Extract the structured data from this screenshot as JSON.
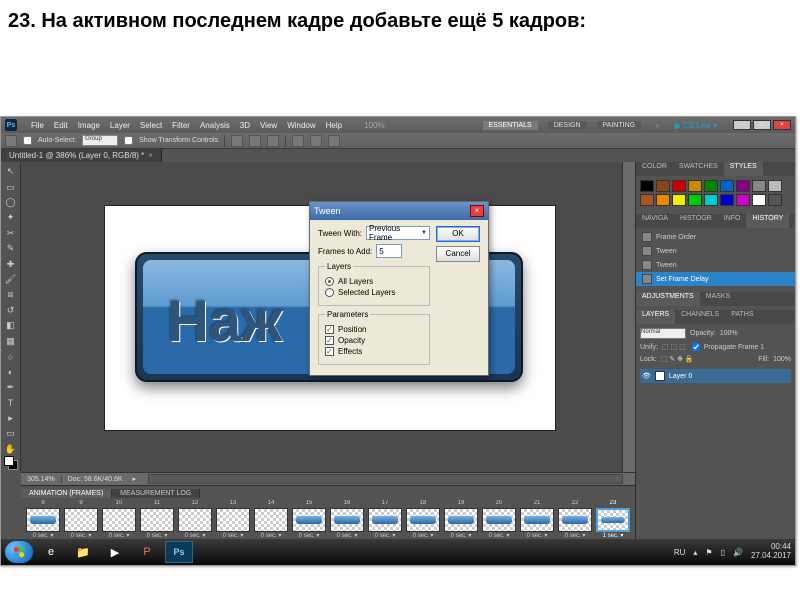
{
  "slide": {
    "title": "23. На активном последнем кадре добавьте ещё 5 кадров:"
  },
  "menubar": {
    "items": [
      "File",
      "Edit",
      "Image",
      "Layer",
      "Select",
      "Filter",
      "Analysis",
      "3D",
      "View",
      "Window",
      "Help"
    ],
    "zoom": "100%",
    "workspaces": {
      "essentials": "ESSENTIALS",
      "design": "DESIGN",
      "painting": "PAINTING"
    },
    "cslive": "CS Live"
  },
  "optbar": {
    "autoSelect": "Auto-Select:",
    "group": "Group",
    "showTransform": "Show Transform Controls"
  },
  "doctab": {
    "title": "Untitled-1 @ 386% (Layer 0, RGB/8) *"
  },
  "canvasText": "Наж",
  "statusbar": {
    "zoom": "305.14%",
    "doc": "Doc: 58.6K/40.6K"
  },
  "anim": {
    "tabs": {
      "frames": "ANIMATION (FRAMES)",
      "log": "MEASUREMENT LOG"
    },
    "frames": [
      {
        "n": "8",
        "d": "0 sec.",
        "btn": true
      },
      {
        "n": "9",
        "d": "0 sec.",
        "btn": false
      },
      {
        "n": "10",
        "d": "0 sec.",
        "btn": false
      },
      {
        "n": "11",
        "d": "0 sec.",
        "btn": false
      },
      {
        "n": "12",
        "d": "0 sec.",
        "btn": false
      },
      {
        "n": "13",
        "d": "0 sec.",
        "btn": false
      },
      {
        "n": "14",
        "d": "0 sec.",
        "btn": false
      },
      {
        "n": "15",
        "d": "0 sec.",
        "btn": true
      },
      {
        "n": "16",
        "d": "0 sec.",
        "btn": true
      },
      {
        "n": "17",
        "d": "0 sec.",
        "btn": true
      },
      {
        "n": "18",
        "d": "0 sec.",
        "btn": true
      },
      {
        "n": "19",
        "d": "0 sec.",
        "btn": true
      },
      {
        "n": "20",
        "d": "0 sec.",
        "btn": true
      },
      {
        "n": "21",
        "d": "0 sec.",
        "btn": true
      },
      {
        "n": "22",
        "d": "0 sec.",
        "btn": true
      },
      {
        "n": "23",
        "d": "1 sec.",
        "btn": true,
        "sel": true
      }
    ]
  },
  "rpanel": {
    "group1": {
      "tabs": [
        "COLOR",
        "SWATCHES",
        "STYLES"
      ],
      "active": "STYLES"
    },
    "swatchColors": [
      "#000",
      "#8b4513",
      "#c00",
      "#c80",
      "#080",
      "#06c",
      "#808",
      "#888",
      "#bbb",
      "#a52",
      "#e80",
      "#ee0",
      "#0c0",
      "#0cc",
      "#00c",
      "#c0c",
      "#fff",
      "#555"
    ],
    "group2": {
      "tabs": [
        "NAVIGA",
        "HISTOGR",
        "INFO",
        "HISTORY"
      ],
      "active": "HISTORY",
      "rows": [
        "Frame Order",
        "Tween",
        "Tween",
        "Set Frame Delay"
      ],
      "selIndex": 3
    },
    "group3": {
      "tabs": [
        "ADJUSTMENTS",
        "MASKS"
      ]
    },
    "group4": {
      "tabs": [
        "LAYERS",
        "CHANNELS",
        "PATHS"
      ],
      "active": "LAYERS",
      "mode": "Normal",
      "opacityLbl": "Opacity:",
      "opacity": "100%",
      "unify": "Unify:",
      "propagate": "Propagate Frame 1",
      "lockLbl": "Lock:",
      "fillLbl": "Fill:",
      "fill": "100%",
      "layerName": "Layer 0"
    }
  },
  "dialog": {
    "title": "Tween",
    "tweenWithLbl": "Tween With:",
    "tweenWith": "Previous Frame",
    "framesLbl": "Frames to Add:",
    "frames": "5",
    "layersLegend": "Layers",
    "allLayers": "All Layers",
    "selLayers": "Selected Layers",
    "paramsLegend": "Parameters",
    "position": "Position",
    "opacity": "Opacity",
    "effects": "Effects",
    "ok": "OK",
    "cancel": "Cancel"
  },
  "taskbar": {
    "lang": "RU",
    "time": "00:44",
    "date": "27.04.2017"
  }
}
